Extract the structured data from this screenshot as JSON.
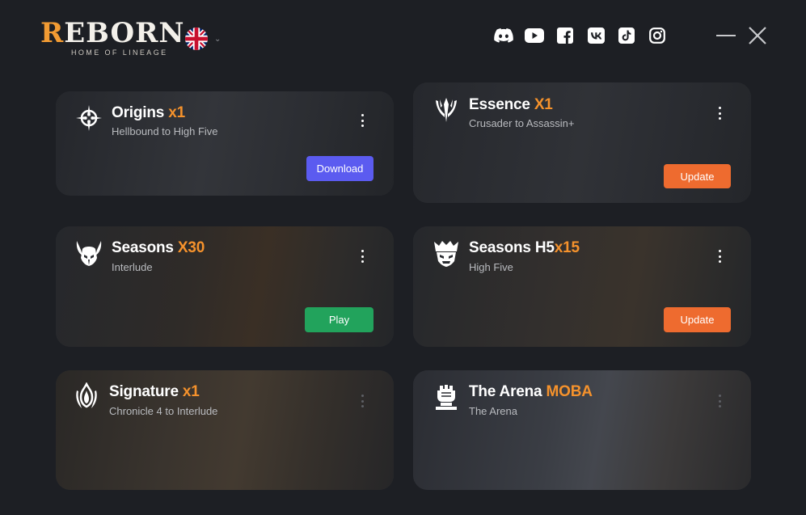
{
  "header": {
    "logo": {
      "word_first": "R",
      "word_rest": "EBORN",
      "tagline": "HOME OF LINEAGE"
    },
    "language": {
      "flag": "uk-flag",
      "caret": "⌄"
    },
    "social": [
      "discord-icon",
      "youtube-icon",
      "facebook-icon",
      "vk-icon",
      "tiktok-icon",
      "instagram-icon"
    ],
    "window": {
      "minimize": "minimize-icon",
      "close": "close-icon"
    }
  },
  "cards": [
    {
      "name": "Origins",
      "rate": "x1",
      "subtitle": "Hellbound to High Five",
      "action": "Download",
      "action_type": "download",
      "icon": "compass-icon"
    },
    {
      "name": "Essence",
      "rate": "X1",
      "subtitle": "Crusader to Assassin+",
      "action": "Update",
      "action_type": "update",
      "icon": "trident-icon"
    },
    {
      "name": "Seasons",
      "rate": "X30",
      "subtitle": "Interlude",
      "action": "Play",
      "action_type": "play",
      "icon": "horned-helmet-icon"
    },
    {
      "name": "Seasons H5",
      "rate": "x15",
      "subtitle": "High Five",
      "action": "Update",
      "action_type": "update",
      "icon": "crown-helmet-icon"
    },
    {
      "name": "Signature",
      "rate": "x1",
      "subtitle": "Chronicle 4 to Interlude",
      "action": "",
      "action_type": "none",
      "icon": "flame-icon"
    },
    {
      "name": "The Arena",
      "rate": "MOBA",
      "subtitle": "The Arena",
      "action": "",
      "action_type": "none",
      "icon": "fist-icon"
    }
  ],
  "colors": {
    "background": "#1d1f24",
    "accent": "#f5922c",
    "download": "#5b5bf0",
    "update": "#ee6b2f",
    "play": "#22a35c"
  }
}
